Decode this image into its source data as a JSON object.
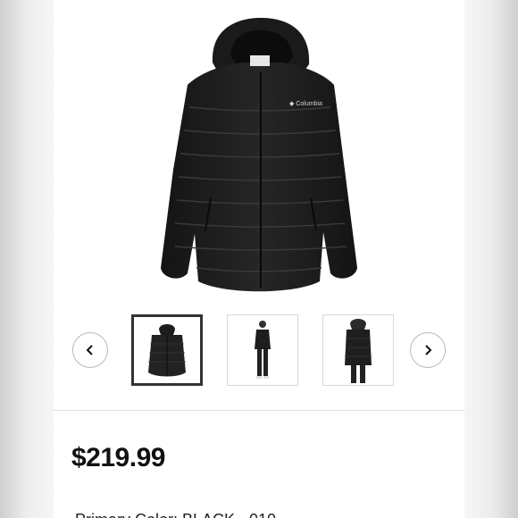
{
  "product": {
    "name": "Columbia hooded puffer jacket",
    "brand_logo": "Columbia",
    "price": "$219.99",
    "variant_line": "Primary Color: BLACK - 010"
  },
  "gallery": {
    "selected_index": 0,
    "prev_icon": "chevron-left-icon",
    "next_icon": "chevron-right-icon",
    "thumbnails": [
      {
        "view": "jacket-front",
        "selected": true
      },
      {
        "view": "model-front",
        "selected": false
      },
      {
        "view": "model-back",
        "selected": false
      }
    ]
  },
  "colors": {
    "jacket": "#1c1c1c",
    "page_bg": "#ffffff",
    "thumb_selected_border": "#333333"
  }
}
